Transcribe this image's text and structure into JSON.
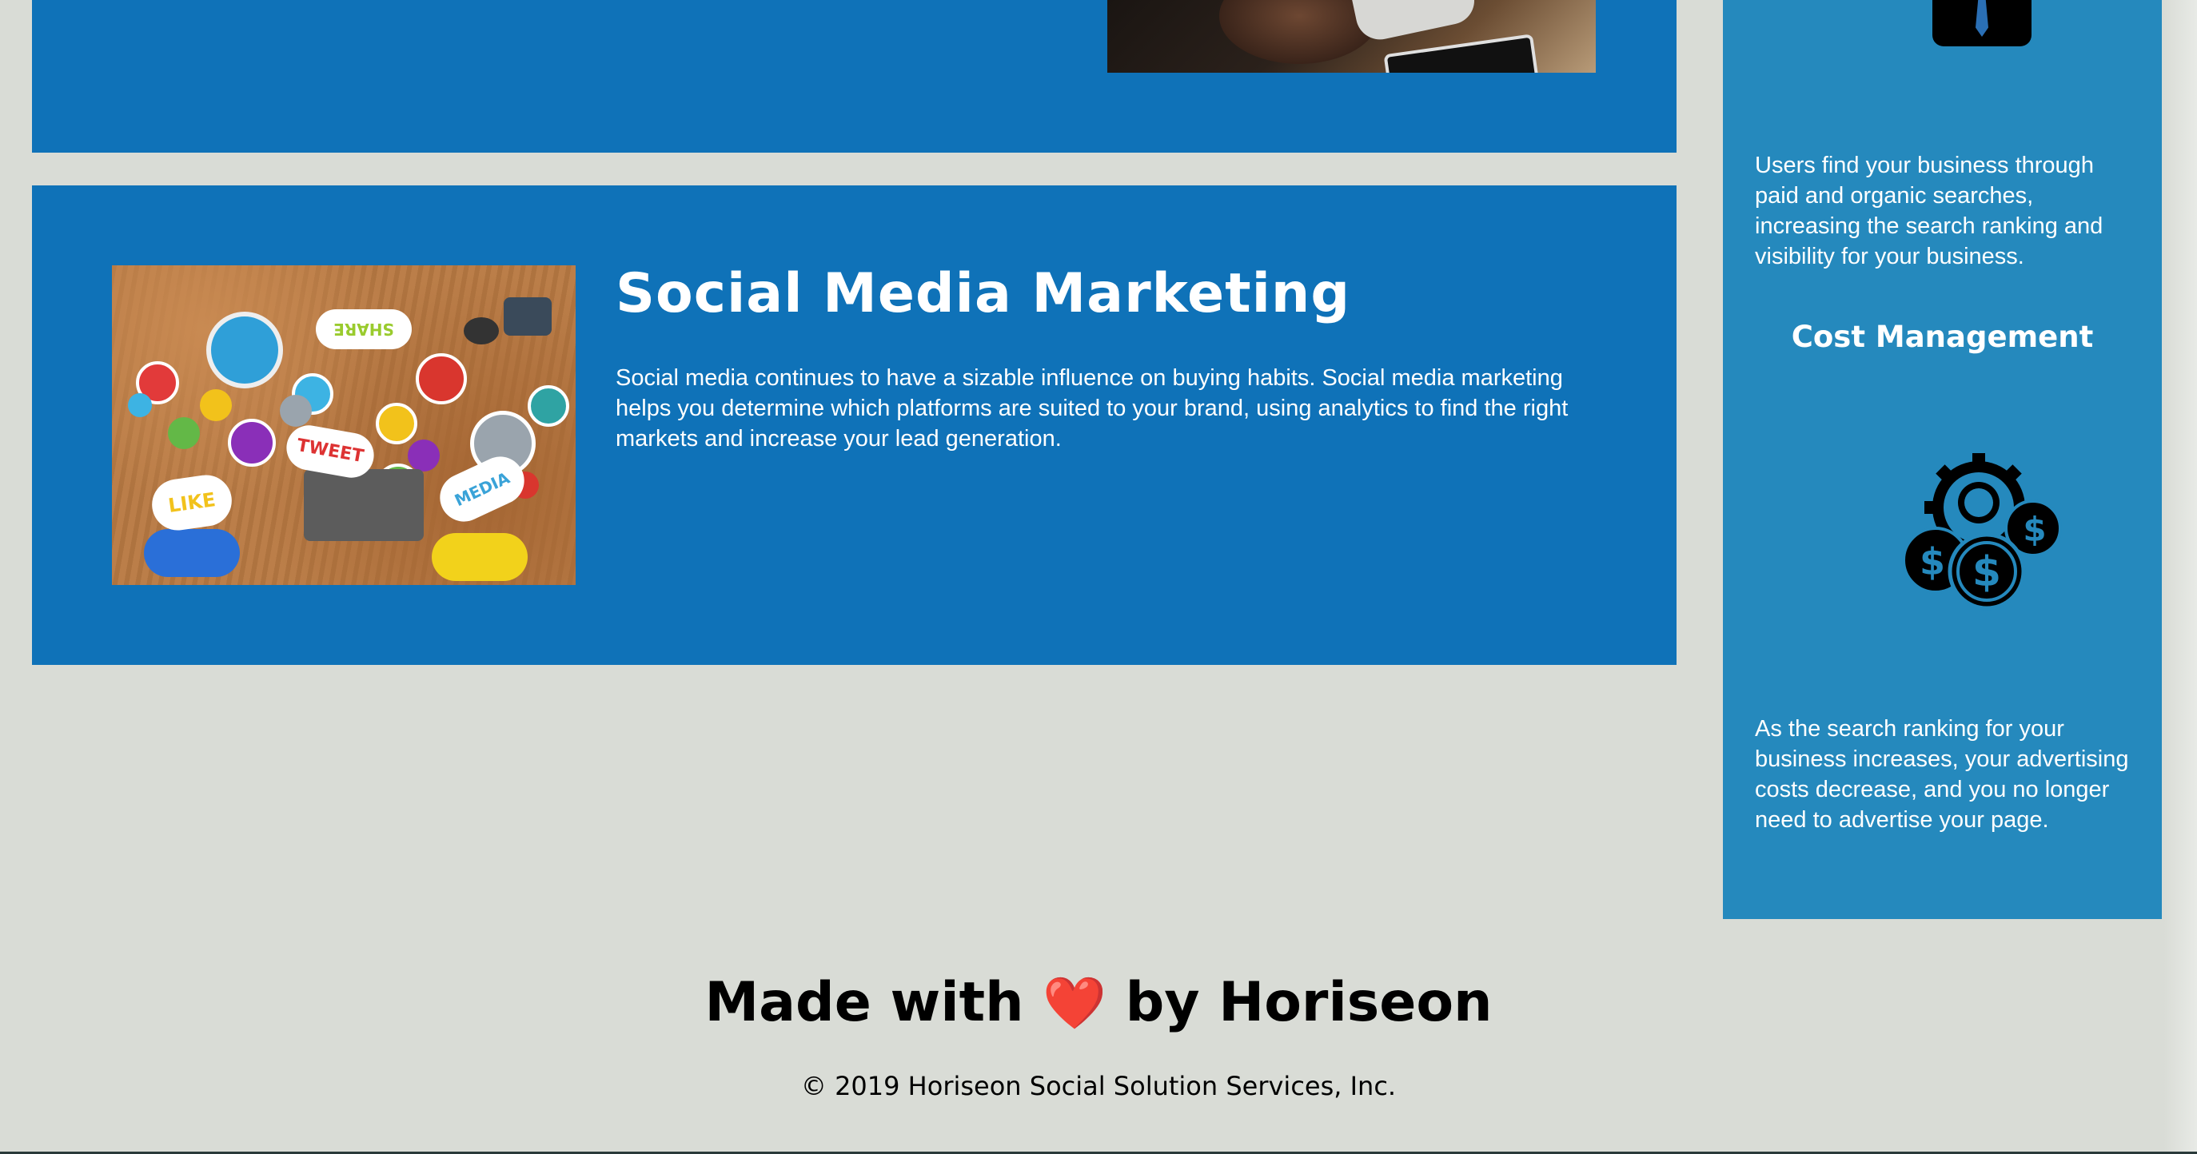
{
  "social_media": {
    "title": "Social Media Marketing",
    "text": "Social media continues to have a sizable influence on buying habits. Social media marketing helps you determine which platforms are suited to your brand, using analytics to find the right markets and increase your lead generation.",
    "image_labels": {
      "share": "SHARE",
      "tweet": "TWEET",
      "like": "LIKE",
      "media": "MEDIA"
    }
  },
  "benefits": {
    "text_1": "Users find your business through paid and organic searches, increasing the search ranking and visibility for your business.",
    "cost_heading": "Cost Management",
    "cost_text": "As the search ranking for your business increases, your advertising costs decrease, and you no longer need to advertise your page."
  },
  "footer": {
    "made_with_prefix": "Made with",
    "heart": "❤️",
    "made_with_suffix": "by Horiseon",
    "copyright": "© 2019 Horiseon Social Solution Services, Inc."
  },
  "colors": {
    "page_bg": "#d9dcd6",
    "card_bg": "#0f72b8",
    "benefits_bg": "#2589bd",
    "text_light": "#ffffff",
    "heart": "#e01d1d"
  },
  "icons": {
    "benefit_top": "business-person-icon",
    "cost": "cost-management-icon"
  }
}
